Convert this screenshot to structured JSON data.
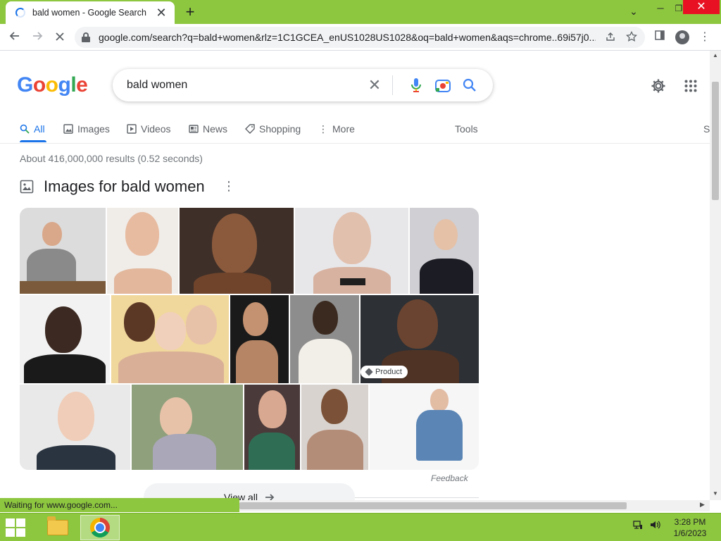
{
  "browser": {
    "tab_title": "bald women - Google Search",
    "tab_close": "✕",
    "new_tab": "+",
    "url": "google.com/search?q=bald+women&rlz=1C1GCEA_enUS1028US1028&oq=bald+women&aqs=chrome..69i57j0...",
    "status_text": "Waiting for www.google.com..."
  },
  "logo": [
    "G",
    "o",
    "o",
    "g",
    "l",
    "e"
  ],
  "search": {
    "query": "bald women"
  },
  "tabs": {
    "all": "All",
    "images": "Images",
    "videos": "Videos",
    "news": "News",
    "shopping": "Shopping",
    "more": "More",
    "tools": "Tools",
    "cut": "S"
  },
  "results": {
    "stats": "About 416,000,000 results (0.52 seconds)",
    "images_heading": "Images for bald women",
    "product_badge": "Product",
    "feedback": "Feedback",
    "view_all": "View all"
  },
  "taskbar": {
    "time": "3:28 PM",
    "date": "1/6/2023"
  },
  "colors": {
    "theme_green": "#8dc63f",
    "google_blue": "#1a73e8"
  }
}
